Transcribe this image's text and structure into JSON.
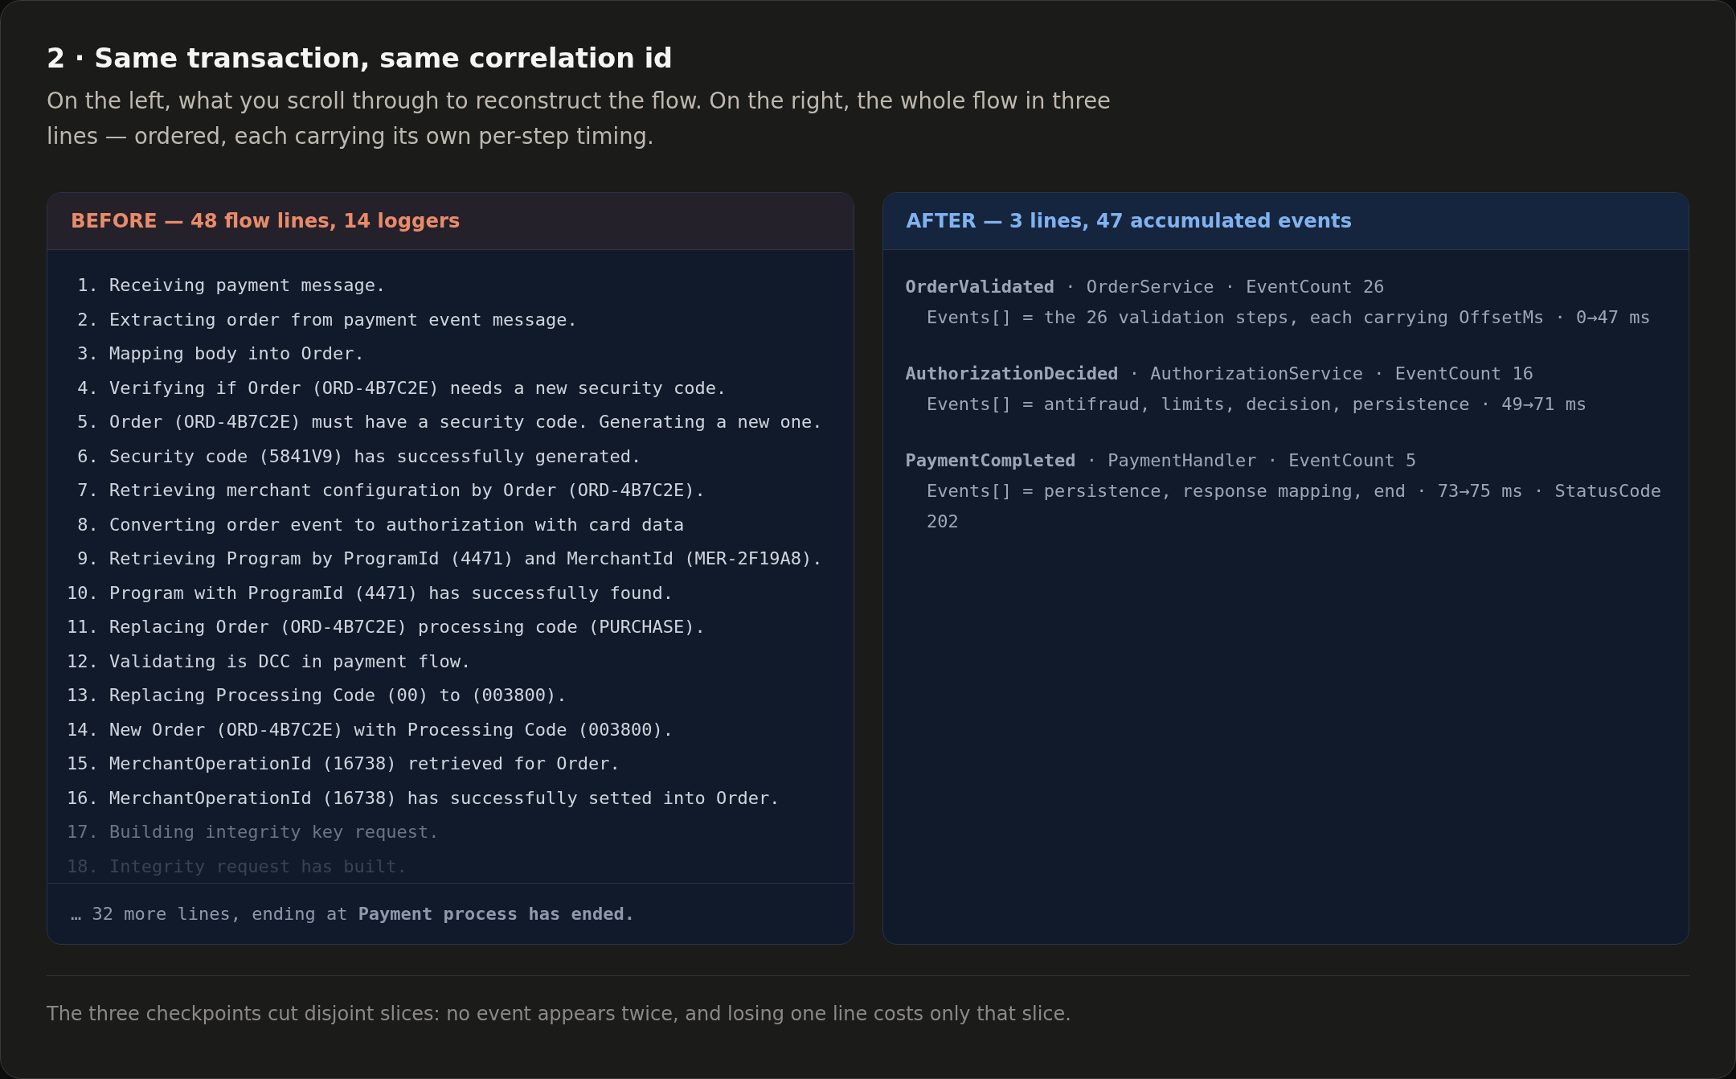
{
  "heading": {
    "title": "2 · Same transaction, same correlation id",
    "subtitle": "On the left, what you scroll through to reconstruct the flow. On the right, the whole flow in three lines — ordered, each carrying its own per-step timing."
  },
  "panels": [
    {
      "kind": "log",
      "title": "BEFORE — 48 flow lines, 14 loggers",
      "lines": [
        {
          "number": "1.",
          "text": "Receiving payment message.",
          "muted": false,
          "faint": false
        },
        {
          "number": "2.",
          "text": "Extracting order from payment event message.",
          "muted": false,
          "faint": false
        },
        {
          "number": "3.",
          "text": "Mapping body into Order.",
          "muted": false,
          "faint": false
        },
        {
          "number": "4.",
          "text": "Verifying if Order (ORD-4B7C2E) needs a new security code.",
          "muted": false,
          "faint": false
        },
        {
          "number": "5.",
          "text": "Order (ORD-4B7C2E) must have a security code. Generating a new one.",
          "muted": false,
          "faint": false
        },
        {
          "number": "6.",
          "text": "Security code (5841V9) has successfully generated.",
          "muted": false,
          "faint": false
        },
        {
          "number": "7.",
          "text": "Retrieving merchant configuration by Order (ORD-4B7C2E).",
          "muted": false,
          "faint": false
        },
        {
          "number": "8.",
          "text": "Converting order event to authorization with card data",
          "muted": false,
          "faint": false
        },
        {
          "number": "9.",
          "text": "Retrieving Program by ProgramId (4471) and MerchantId (MER-2F19A8).",
          "muted": false,
          "faint": false
        },
        {
          "number": "10.",
          "text": "Program with ProgramId (4471) has successfully found.",
          "muted": false,
          "faint": false
        },
        {
          "number": "11.",
          "text": "Replacing Order (ORD-4B7C2E) processing code (PURCHASE).",
          "muted": false,
          "faint": false
        },
        {
          "number": "12.",
          "text": "Validating is DCC in payment flow.",
          "muted": false,
          "faint": false
        },
        {
          "number": "13.",
          "text": "Replacing Processing Code (00) to (003800).",
          "muted": false,
          "faint": false
        },
        {
          "number": "14.",
          "text": "New Order (ORD-4B7C2E) with Processing Code (003800).",
          "muted": false,
          "faint": false
        },
        {
          "number": "15.",
          "text": "MerchantOperationId (16738) retrieved for Order.",
          "muted": false,
          "faint": false
        },
        {
          "number": "16.",
          "text": "MerchantOperationId (16738) has successfully setted into Order.",
          "muted": false,
          "faint": false
        },
        {
          "number": "17.",
          "text": "Building integrity key request.",
          "muted": true,
          "faint": false
        },
        {
          "number": "18.",
          "text": "Integrity request has built.",
          "muted": true,
          "faint": true
        }
      ],
      "footer": "… 32 more lines, ending at **Payment process has ended.**"
    },
    {
      "kind": "events",
      "title": "AFTER — 3 lines, 47 accumulated events",
      "entries": [
        {
          "summary": "**OrderValidated** · OrderService · EventCount 26",
          "events": "Events[] = the 26 validation steps, each carrying OffsetMs · 0→47 ms"
        },
        {
          "summary": "**AuthorizationDecided** · AuthorizationService · EventCount 16",
          "events": "Events[] = antifraud, limits, decision, persistence · 49→71 ms"
        },
        {
          "summary": "**PaymentCompleted** · PaymentHandler · EventCount 5",
          "events": "Events[] = persistence, response mapping, end · 73→75 ms · StatusCode 202"
        }
      ]
    }
  ],
  "note": "The three checkpoints cut disjoint slices: no event appears twice, and losing one line costs only that slice."
}
